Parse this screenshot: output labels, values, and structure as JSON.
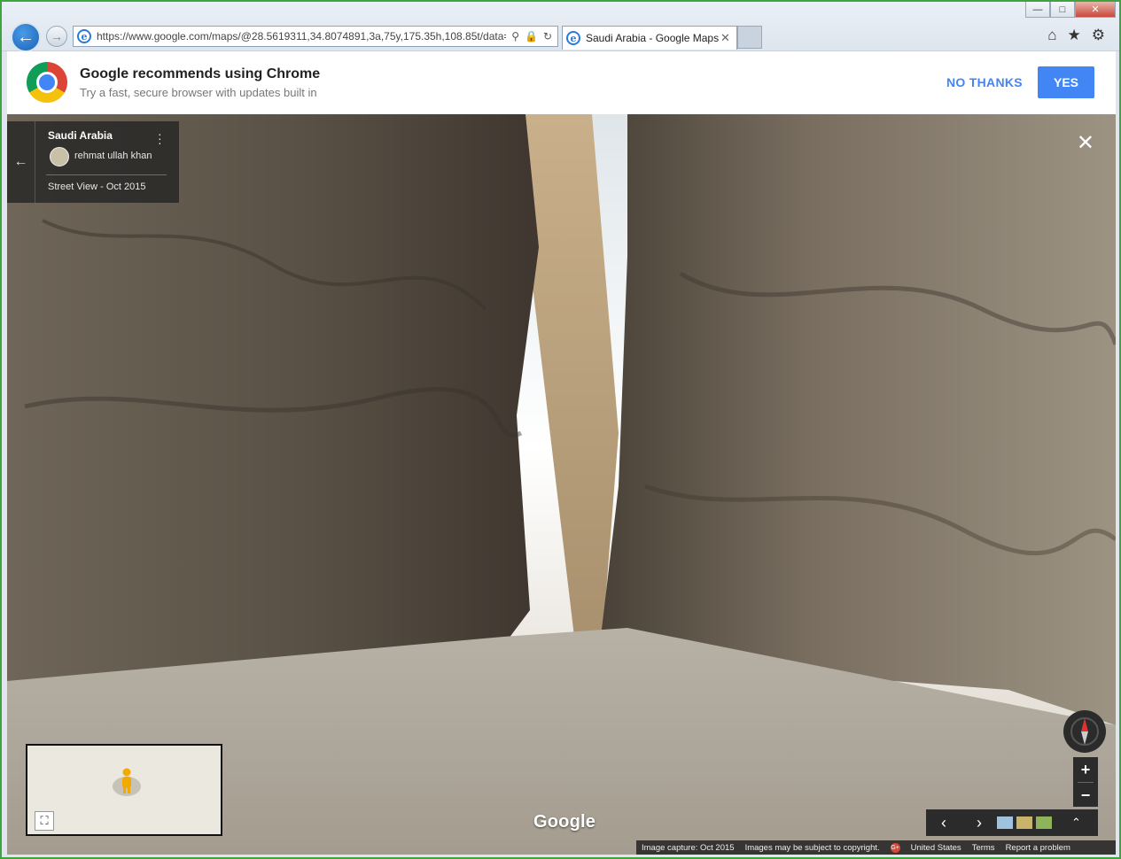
{
  "browser": {
    "address_url": "https://www.google.com/maps/@28.5619311,34.8074891,3a,75y,175.35h,108.85t/data=",
    "tab_title": "Saudi Arabia - Google Maps",
    "window_controls": [
      "minimize",
      "maximize",
      "close"
    ]
  },
  "promo": {
    "title": "Google recommends using Chrome",
    "subtitle": "Try a fast, secure browser with updates built in",
    "no_thanks_label": "NO THANKS",
    "yes_label": "YES"
  },
  "info_card": {
    "title": "Saudi Arabia",
    "author": "rehmat ullah khan",
    "date": "Street View - Oct 2015"
  },
  "map_brand": "Google",
  "footer": {
    "capture": "Image capture: Oct 2015",
    "copyright": "Images may be subject to copyright.",
    "region": "United States",
    "terms": "Terms",
    "report": "Report a problem"
  },
  "colors": {
    "accent_blue": "#4285f4",
    "window_border": "#3fa33f"
  },
  "icons": [
    "back-arrow-icon",
    "forward-arrow-icon",
    "ie-icon",
    "search-icon",
    "lock-icon",
    "refresh-icon",
    "home-icon",
    "star-icon",
    "gear-icon",
    "chrome-logo-icon",
    "kebab-menu-icon",
    "close-icon",
    "pegman-icon",
    "fullscreen-icon",
    "compass-icon",
    "zoom-in-icon",
    "zoom-out-icon",
    "chevron-left-icon",
    "chevron-right-icon",
    "chevron-up-icon",
    "google-plus-icon"
  ]
}
